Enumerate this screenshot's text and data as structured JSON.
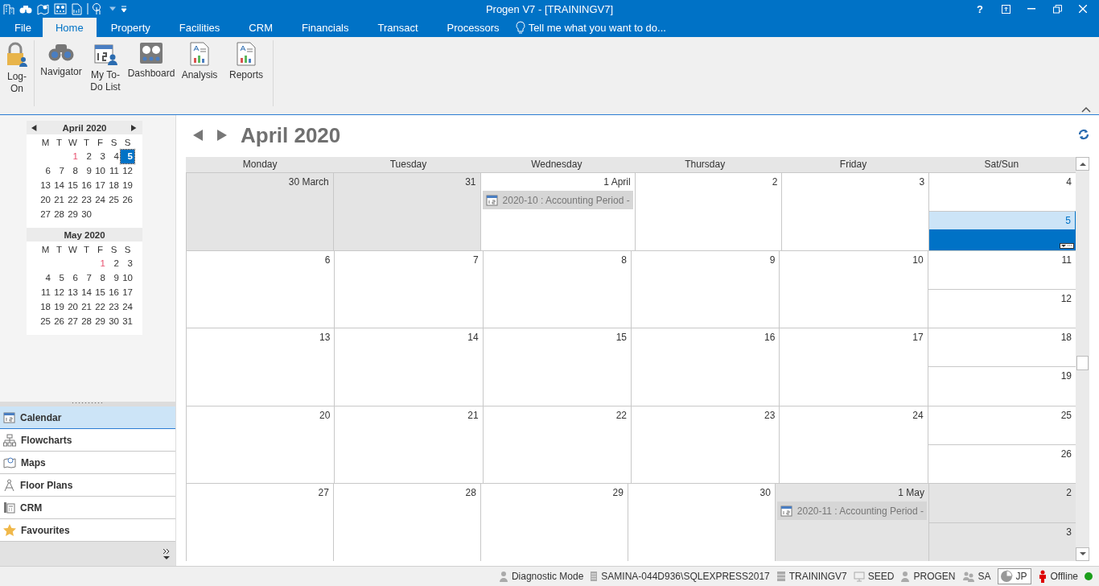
{
  "window": {
    "title": "Progen V7 - [TRAININGV7]",
    "help": "?"
  },
  "quick_access": [
    {
      "kind": "building"
    },
    {
      "kind": "binoculars"
    },
    {
      "kind": "map"
    },
    {
      "kind": "dashboard"
    },
    {
      "kind": "document"
    },
    {
      "kind": "touch"
    }
  ],
  "tabs": [
    {
      "label": "File",
      "selected": false,
      "kind": "file"
    },
    {
      "label": "Home",
      "selected": true,
      "kind": "tab"
    },
    {
      "label": "Property",
      "selected": false,
      "kind": "tab"
    },
    {
      "label": "Facilities",
      "selected": false,
      "kind": "tab"
    },
    {
      "label": "CRM",
      "selected": false,
      "kind": "tab"
    },
    {
      "label": "Financials",
      "selected": false,
      "kind": "tab"
    },
    {
      "label": "Transact",
      "selected": false,
      "kind": "tab"
    },
    {
      "label": "Processors",
      "selected": false,
      "kind": "tab"
    }
  ],
  "tell_me": {
    "placeholder": "Tell me what you want to do..."
  },
  "ribbon": {
    "groups": [
      [
        {
          "label": "Log-On",
          "kind": "lock"
        }
      ],
      [
        {
          "label": "Navigator",
          "kind": "binoculars"
        },
        {
          "label": "My To-Do List",
          "kind": "todo"
        },
        {
          "label": "Dashboard",
          "kind": "dashboard"
        },
        {
          "label": "Analysis",
          "kind": "report"
        },
        {
          "label": "Reports",
          "kind": "report"
        }
      ]
    ]
  },
  "mini_calendars": [
    {
      "title": "April 2020",
      "weekdays": [
        "M",
        "T",
        "W",
        "T",
        "F",
        "S",
        "S"
      ],
      "weeks": [
        [
          {
            "day": "1",
            "marked": true,
            "selected": false
          },
          {
            "day": "2",
            "marked": false,
            "selected": false
          },
          {
            "day": "3",
            "marked": false,
            "selected": false
          },
          {
            "day": "4",
            "marked": false,
            "selected": false
          },
          {
            "day": "5",
            "marked": false,
            "selected": true
          }
        ],
        [
          {
            "day": "6",
            "marked": false,
            "selected": false
          },
          {
            "day": "7",
            "marked": false,
            "selected": false
          },
          {
            "day": "8",
            "marked": false,
            "selected": false
          },
          {
            "day": "9",
            "marked": false,
            "selected": false
          },
          {
            "day": "10",
            "marked": false,
            "selected": false
          },
          {
            "day": "11",
            "marked": false,
            "selected": false
          },
          {
            "day": "12",
            "marked": false,
            "selected": false
          }
        ],
        [
          {
            "day": "13",
            "marked": false,
            "selected": false
          },
          {
            "day": "14",
            "marked": false,
            "selected": false
          },
          {
            "day": "15",
            "marked": false,
            "selected": false
          },
          {
            "day": "16",
            "marked": false,
            "selected": false
          },
          {
            "day": "17",
            "marked": false,
            "selected": false
          },
          {
            "day": "18",
            "marked": false,
            "selected": false
          },
          {
            "day": "19",
            "marked": false,
            "selected": false
          }
        ],
        [
          {
            "day": "20",
            "marked": false,
            "selected": false
          },
          {
            "day": "21",
            "marked": false,
            "selected": false
          },
          {
            "day": "22",
            "marked": false,
            "selected": false
          },
          {
            "day": "23",
            "marked": false,
            "selected": false
          },
          {
            "day": "24",
            "marked": false,
            "selected": false
          },
          {
            "day": "25",
            "marked": false,
            "selected": false
          },
          {
            "day": "26",
            "marked": false,
            "selected": false
          }
        ],
        [
          {
            "day": "27",
            "marked": false,
            "selected": false
          },
          {
            "day": "28",
            "marked": false,
            "selected": false
          },
          {
            "day": "29",
            "marked": false,
            "selected": false
          },
          {
            "day": "30",
            "marked": false,
            "selected": false
          }
        ]
      ]
    },
    {
      "title": "May 2020",
      "weekdays": [
        "M",
        "T",
        "W",
        "T",
        "F",
        "S",
        "S"
      ],
      "weeks": [
        [
          {
            "day": "1",
            "marked": true,
            "selected": false
          },
          {
            "day": "2",
            "marked": false,
            "selected": false
          },
          {
            "day": "3",
            "marked": false,
            "selected": false
          }
        ],
        [
          {
            "day": "4",
            "marked": false,
            "selected": false
          },
          {
            "day": "5",
            "marked": false,
            "selected": false
          },
          {
            "day": "6",
            "marked": false,
            "selected": false
          },
          {
            "day": "7",
            "marked": false,
            "selected": false
          },
          {
            "day": "8",
            "marked": false,
            "selected": false
          },
          {
            "day": "9",
            "marked": false,
            "selected": false
          },
          {
            "day": "10",
            "marked": false,
            "selected": false
          }
        ],
        [
          {
            "day": "11",
            "marked": false,
            "selected": false
          },
          {
            "day": "12",
            "marked": false,
            "selected": false
          },
          {
            "day": "13",
            "marked": false,
            "selected": false
          },
          {
            "day": "14",
            "marked": false,
            "selected": false
          },
          {
            "day": "15",
            "marked": false,
            "selected": false
          },
          {
            "day": "16",
            "marked": false,
            "selected": false
          },
          {
            "day": "17",
            "marked": false,
            "selected": false
          }
        ],
        [
          {
            "day": "18",
            "marked": false,
            "selected": false
          },
          {
            "day": "19",
            "marked": false,
            "selected": false
          },
          {
            "day": "20",
            "marked": false,
            "selected": false
          },
          {
            "day": "21",
            "marked": false,
            "selected": false
          },
          {
            "day": "22",
            "marked": false,
            "selected": false
          },
          {
            "day": "23",
            "marked": false,
            "selected": false
          },
          {
            "day": "24",
            "marked": false,
            "selected": false
          }
        ],
        [
          {
            "day": "25",
            "marked": false,
            "selected": false
          },
          {
            "day": "26",
            "marked": false,
            "selected": false
          },
          {
            "day": "27",
            "marked": false,
            "selected": false
          },
          {
            "day": "28",
            "marked": false,
            "selected": false
          },
          {
            "day": "29",
            "marked": false,
            "selected": false
          },
          {
            "day": "30",
            "marked": false,
            "selected": false
          },
          {
            "day": "31",
            "marked": false,
            "selected": false
          }
        ]
      ]
    }
  ],
  "nav_items": [
    {
      "label": "Calendar",
      "kind": "calendar",
      "selected": true
    },
    {
      "label": "Flowcharts",
      "kind": "flowchart",
      "selected": false
    },
    {
      "label": "Maps",
      "kind": "map",
      "selected": false
    },
    {
      "label": "Floor Plans",
      "kind": "compass",
      "selected": false
    },
    {
      "label": "CRM",
      "kind": "phone",
      "selected": false
    },
    {
      "label": "Favourites",
      "kind": "star",
      "selected": false
    }
  ],
  "calendar": {
    "title": "April 2020",
    "columns": [
      "Monday",
      "Tuesday",
      "Wednesday",
      "Thursday",
      "Friday",
      "Sat/Sun"
    ],
    "weeks": [
      [
        {
          "label": "30 March",
          "other_month": true,
          "selected": false
        },
        {
          "label": "31",
          "other_month": true,
          "selected": false
        },
        {
          "label": "1 April",
          "other_month": false,
          "selected": false,
          "events": [
            "2020-10 : Accounting Period -"
          ]
        },
        {
          "label": "2",
          "other_month": false,
          "selected": false
        },
        {
          "label": "3",
          "other_month": false,
          "selected": false
        },
        {
          "label": "4",
          "other_month": false,
          "selected": false
        },
        {
          "label": "5",
          "other_month": false,
          "selected": true
        }
      ],
      [
        {
          "label": "6",
          "other_month": false,
          "selected": false
        },
        {
          "label": "7",
          "other_month": false,
          "selected": false
        },
        {
          "label": "8",
          "other_month": false,
          "selected": false
        },
        {
          "label": "9",
          "other_month": false,
          "selected": false
        },
        {
          "label": "10",
          "other_month": false,
          "selected": false
        },
        {
          "label": "11",
          "other_month": false,
          "selected": false
        },
        {
          "label": "12",
          "other_month": false,
          "selected": false
        }
      ],
      [
        {
          "label": "13",
          "other_month": false,
          "selected": false
        },
        {
          "label": "14",
          "other_month": false,
          "selected": false
        },
        {
          "label": "15",
          "other_month": false,
          "selected": false
        },
        {
          "label": "16",
          "other_month": false,
          "selected": false
        },
        {
          "label": "17",
          "other_month": false,
          "selected": false
        },
        {
          "label": "18",
          "other_month": false,
          "selected": false
        },
        {
          "label": "19",
          "other_month": false,
          "selected": false
        }
      ],
      [
        {
          "label": "20",
          "other_month": false,
          "selected": false
        },
        {
          "label": "21",
          "other_month": false,
          "selected": false
        },
        {
          "label": "22",
          "other_month": false,
          "selected": false
        },
        {
          "label": "23",
          "other_month": false,
          "selected": false
        },
        {
          "label": "24",
          "other_month": false,
          "selected": false
        },
        {
          "label": "25",
          "other_month": false,
          "selected": false
        },
        {
          "label": "26",
          "other_month": false,
          "selected": false
        }
      ],
      [
        {
          "label": "27",
          "other_month": false,
          "selected": false
        },
        {
          "label": "28",
          "other_month": false,
          "selected": false
        },
        {
          "label": "29",
          "other_month": false,
          "selected": false
        },
        {
          "label": "30",
          "other_month": false,
          "selected": false
        },
        {
          "label": "1 May",
          "other_month": true,
          "selected": false,
          "events": [
            "2020-11 : Accounting Period -"
          ]
        },
        {
          "label": "2",
          "other_month": true,
          "selected": false
        },
        {
          "label": "3",
          "other_month": true,
          "selected": false
        }
      ]
    ]
  },
  "status_bar": [
    {
      "label": "Diagnostic Mode",
      "kind": "diagnostic"
    },
    {
      "label": "SAMINA-044D936\\SQLEXPRESS2017",
      "kind": "server"
    },
    {
      "label": "TRAININGV7",
      "kind": "database"
    },
    {
      "label": "SEED",
      "kind": "monitor"
    },
    {
      "label": "PROGEN",
      "kind": "user"
    },
    {
      "label": "SA",
      "kind": "users"
    },
    {
      "label": "JP",
      "kind": "pie"
    },
    {
      "label": "Offline",
      "kind": "offline"
    }
  ]
}
